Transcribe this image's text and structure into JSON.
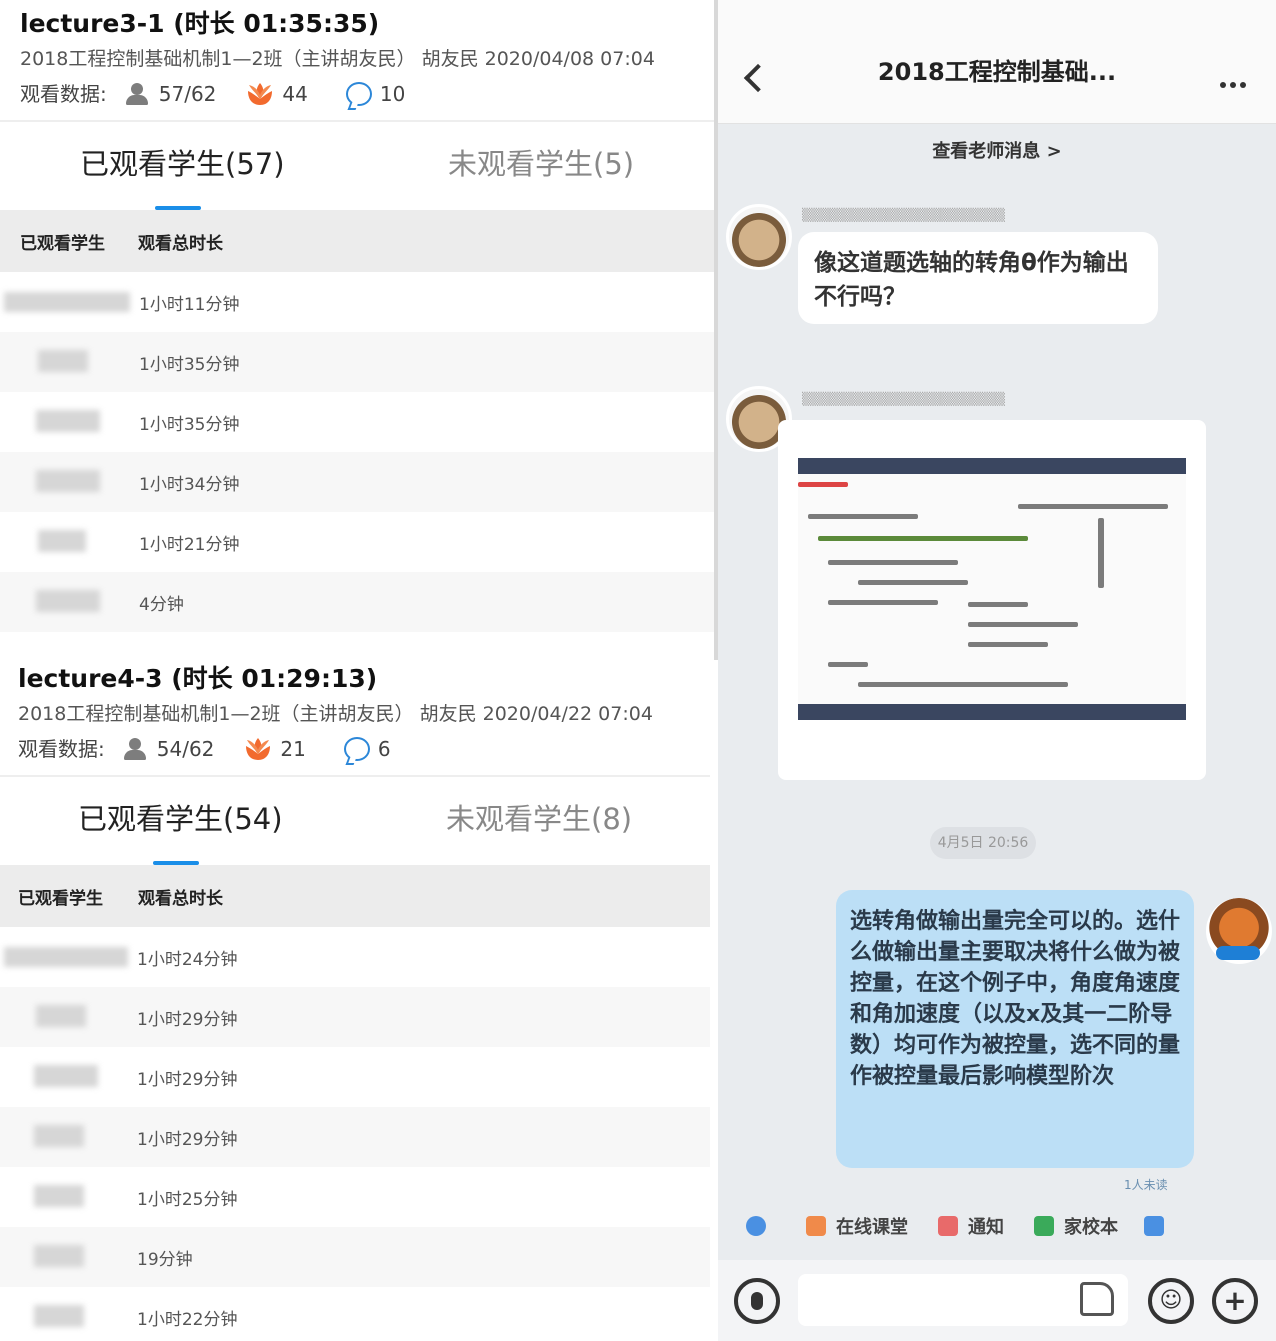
{
  "lectures": [
    {
      "title": "lecture3-1 (时长 01:35:35)",
      "meta": "2018工程控制基础机制1—2班（主讲胡友民） 胡友民 2020/04/08 07:04",
      "stats_label": "观看数据:",
      "viewers": "57/62",
      "flowers": "44",
      "comments": "10",
      "tab_watched": "已观看学生(57)",
      "tab_unwatched": "未观看学生(5)",
      "col_student": "已观看学生",
      "col_duration": "观看总时长",
      "rows": [
        "1小时11分钟",
        "1小时35分钟",
        "1小时35分钟",
        "1小时34分钟",
        "1小时21分钟",
        "4分钟"
      ]
    },
    {
      "title": "lecture4-3 (时长 01:29:13)",
      "meta": "2018工程控制基础机制1—2班（主讲胡友民） 胡友民 2020/04/22 07:04",
      "stats_label": "观看数据:",
      "viewers": "54/62",
      "flowers": "21",
      "comments": "6",
      "tab_watched": "已观看学生(54)",
      "tab_unwatched": "未观看学生(8)",
      "col_student": "已观看学生",
      "col_duration": "观看总时长",
      "rows": [
        "1小时24分钟",
        "1小时29分钟",
        "1小时29分钟",
        "1小时29分钟",
        "1小时25分钟",
        "19分钟",
        "1小时22分钟"
      ]
    }
  ],
  "chat": {
    "title": "2018工程控制基础...",
    "view_teacher_messages": "查看老师消息 >",
    "question": "像这道题选轴的转角θ作为输出不行吗？",
    "time_chip": "4月5日 20:56",
    "answer": "选转角做输出量完全可以的。选什么做输出量主要取决将什么做为被控量，在这个例子中，角度角速度和角加速度（以及x及其一二阶导数）均可作为被控量，选不同的量作被控量最后影响模型阶次",
    "read_mark": "1人未读",
    "tools": [
      "在线课堂",
      "通知",
      "家校本"
    ],
    "colors": {
      "bubble_mine": "#bcdff6",
      "accent": "#1a8ee8",
      "flower": "#f26a2e"
    }
  }
}
